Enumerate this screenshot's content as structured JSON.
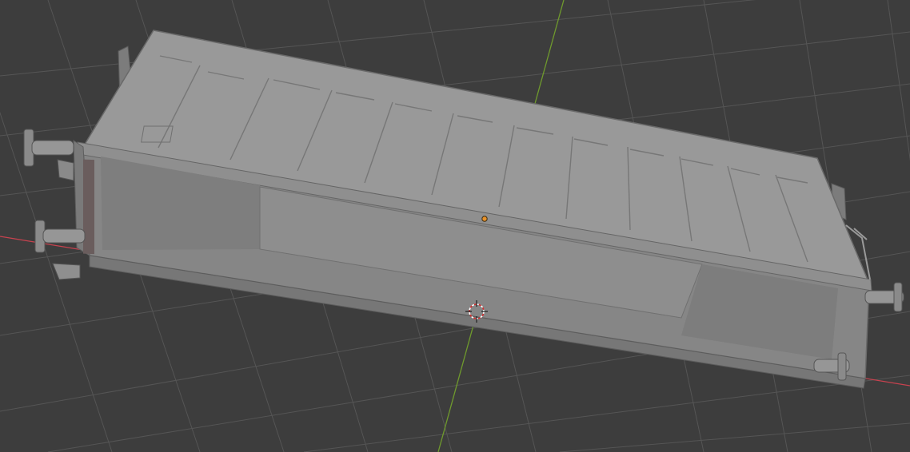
{
  "viewport": {
    "mode": "3D viewport",
    "shading": "solid",
    "background_color": "#3d3d3d",
    "grid_color": "#545454",
    "x_axis_color": "#c8424f",
    "y_axis_color": "#6f9a2d",
    "origin_color": "#e8922a",
    "cursor_color": "#ffffff"
  },
  "object": {
    "kind": "railway freight wagon body (open top)",
    "body_color": "#8c8c8c",
    "top_color": "#9a9a9a",
    "side_color": "#858585",
    "inner_color": "#7b7b7b",
    "selected": false
  },
  "icons": [
    "object-origin-icon",
    "3d-cursor-icon"
  ]
}
